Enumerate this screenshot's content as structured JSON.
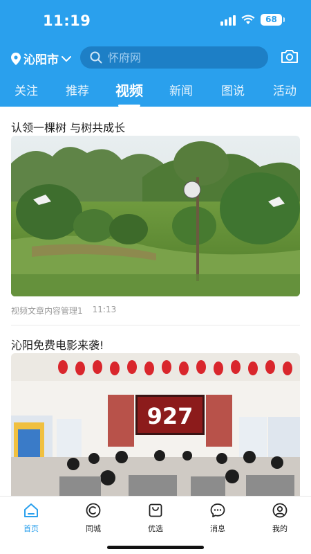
{
  "status_bar": {
    "time": "11:19",
    "battery": "68"
  },
  "header": {
    "location": "沁阳市",
    "search_placeholder": "怀府网"
  },
  "tabs": [
    {
      "label": "关注"
    },
    {
      "label": "推荐"
    },
    {
      "label": "视频",
      "active": true
    },
    {
      "label": "新闻"
    },
    {
      "label": "图说"
    },
    {
      "label": "活动"
    }
  ],
  "articles": [
    {
      "title": "认领一棵树 与树共成长",
      "source": "视频文章内容管理1",
      "time": "11:13"
    },
    {
      "title": "沁阳免费电影来袭!",
      "screen_text": "927"
    }
  ],
  "bottom_nav": [
    {
      "label": "首页",
      "icon": "home-icon",
      "active": true
    },
    {
      "label": "同城",
      "icon": "city-icon"
    },
    {
      "label": "优选",
      "icon": "shopping-bag-icon"
    },
    {
      "label": "消息",
      "icon": "message-icon"
    },
    {
      "label": "我的",
      "icon": "profile-icon"
    }
  ],
  "colors": {
    "brand": "#2aa0ed",
    "search_bg": "#1d7fc6"
  }
}
